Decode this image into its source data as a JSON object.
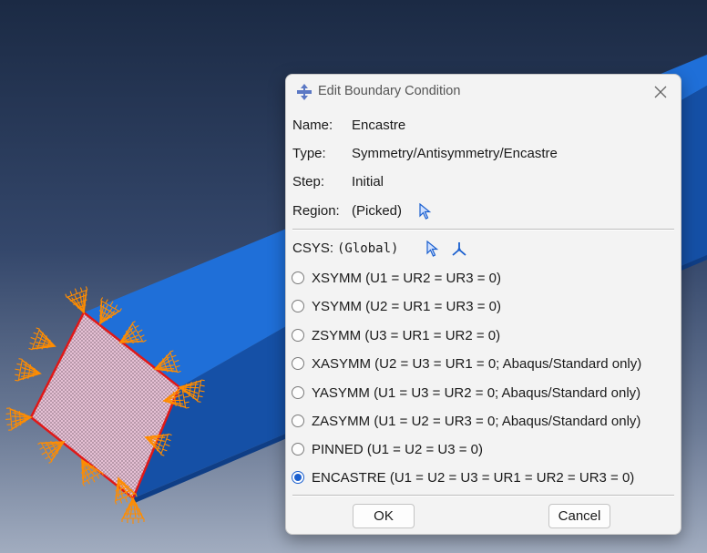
{
  "dialog": {
    "title": "Edit Boundary Condition",
    "fields": {
      "name_label": "Name:",
      "name_value": "Encastre",
      "type_label": "Type:",
      "type_value": "Symmetry/Antisymmetry/Encastre",
      "step_label": "Step:",
      "step_value": "Initial",
      "region_label": "Region:",
      "region_value": "(Picked)"
    },
    "csys": {
      "label": "CSYS:",
      "value": "(Global)"
    },
    "options": [
      {
        "label": "XSYMM (U1 = UR2 = UR3 = 0)",
        "selected": false
      },
      {
        "label": "YSYMM (U2 = UR1 = UR3 = 0)",
        "selected": false
      },
      {
        "label": "ZSYMM (U3 = UR1 = UR2 = 0)",
        "selected": false
      },
      {
        "label": "XASYMM (U2 = U3 = UR1 = 0; Abaqus/Standard only)",
        "selected": false
      },
      {
        "label": "YASYMM (U1 = U3 = UR2 = 0; Abaqus/Standard only)",
        "selected": false
      },
      {
        "label": "ZASYMM (U1 = U2 = UR3 = 0; Abaqus/Standard only)",
        "selected": false
      },
      {
        "label": "PINNED (U1 = U2 = U3 = 0)",
        "selected": false
      },
      {
        "label": "ENCASTRE (U1 = U2 = U3 = UR1 = UR2 = UR3 = 0)",
        "selected": true
      }
    ],
    "buttons": {
      "ok": "OK",
      "cancel": "Cancel"
    }
  },
  "colors": {
    "accent": "#1a5fcf",
    "beam_face": "#1f6fd8",
    "beam_side": "#1550a6",
    "selected_face": "#e9c2d6",
    "face_outline": "#e01818",
    "bc_symbols": "#ff8c00"
  }
}
